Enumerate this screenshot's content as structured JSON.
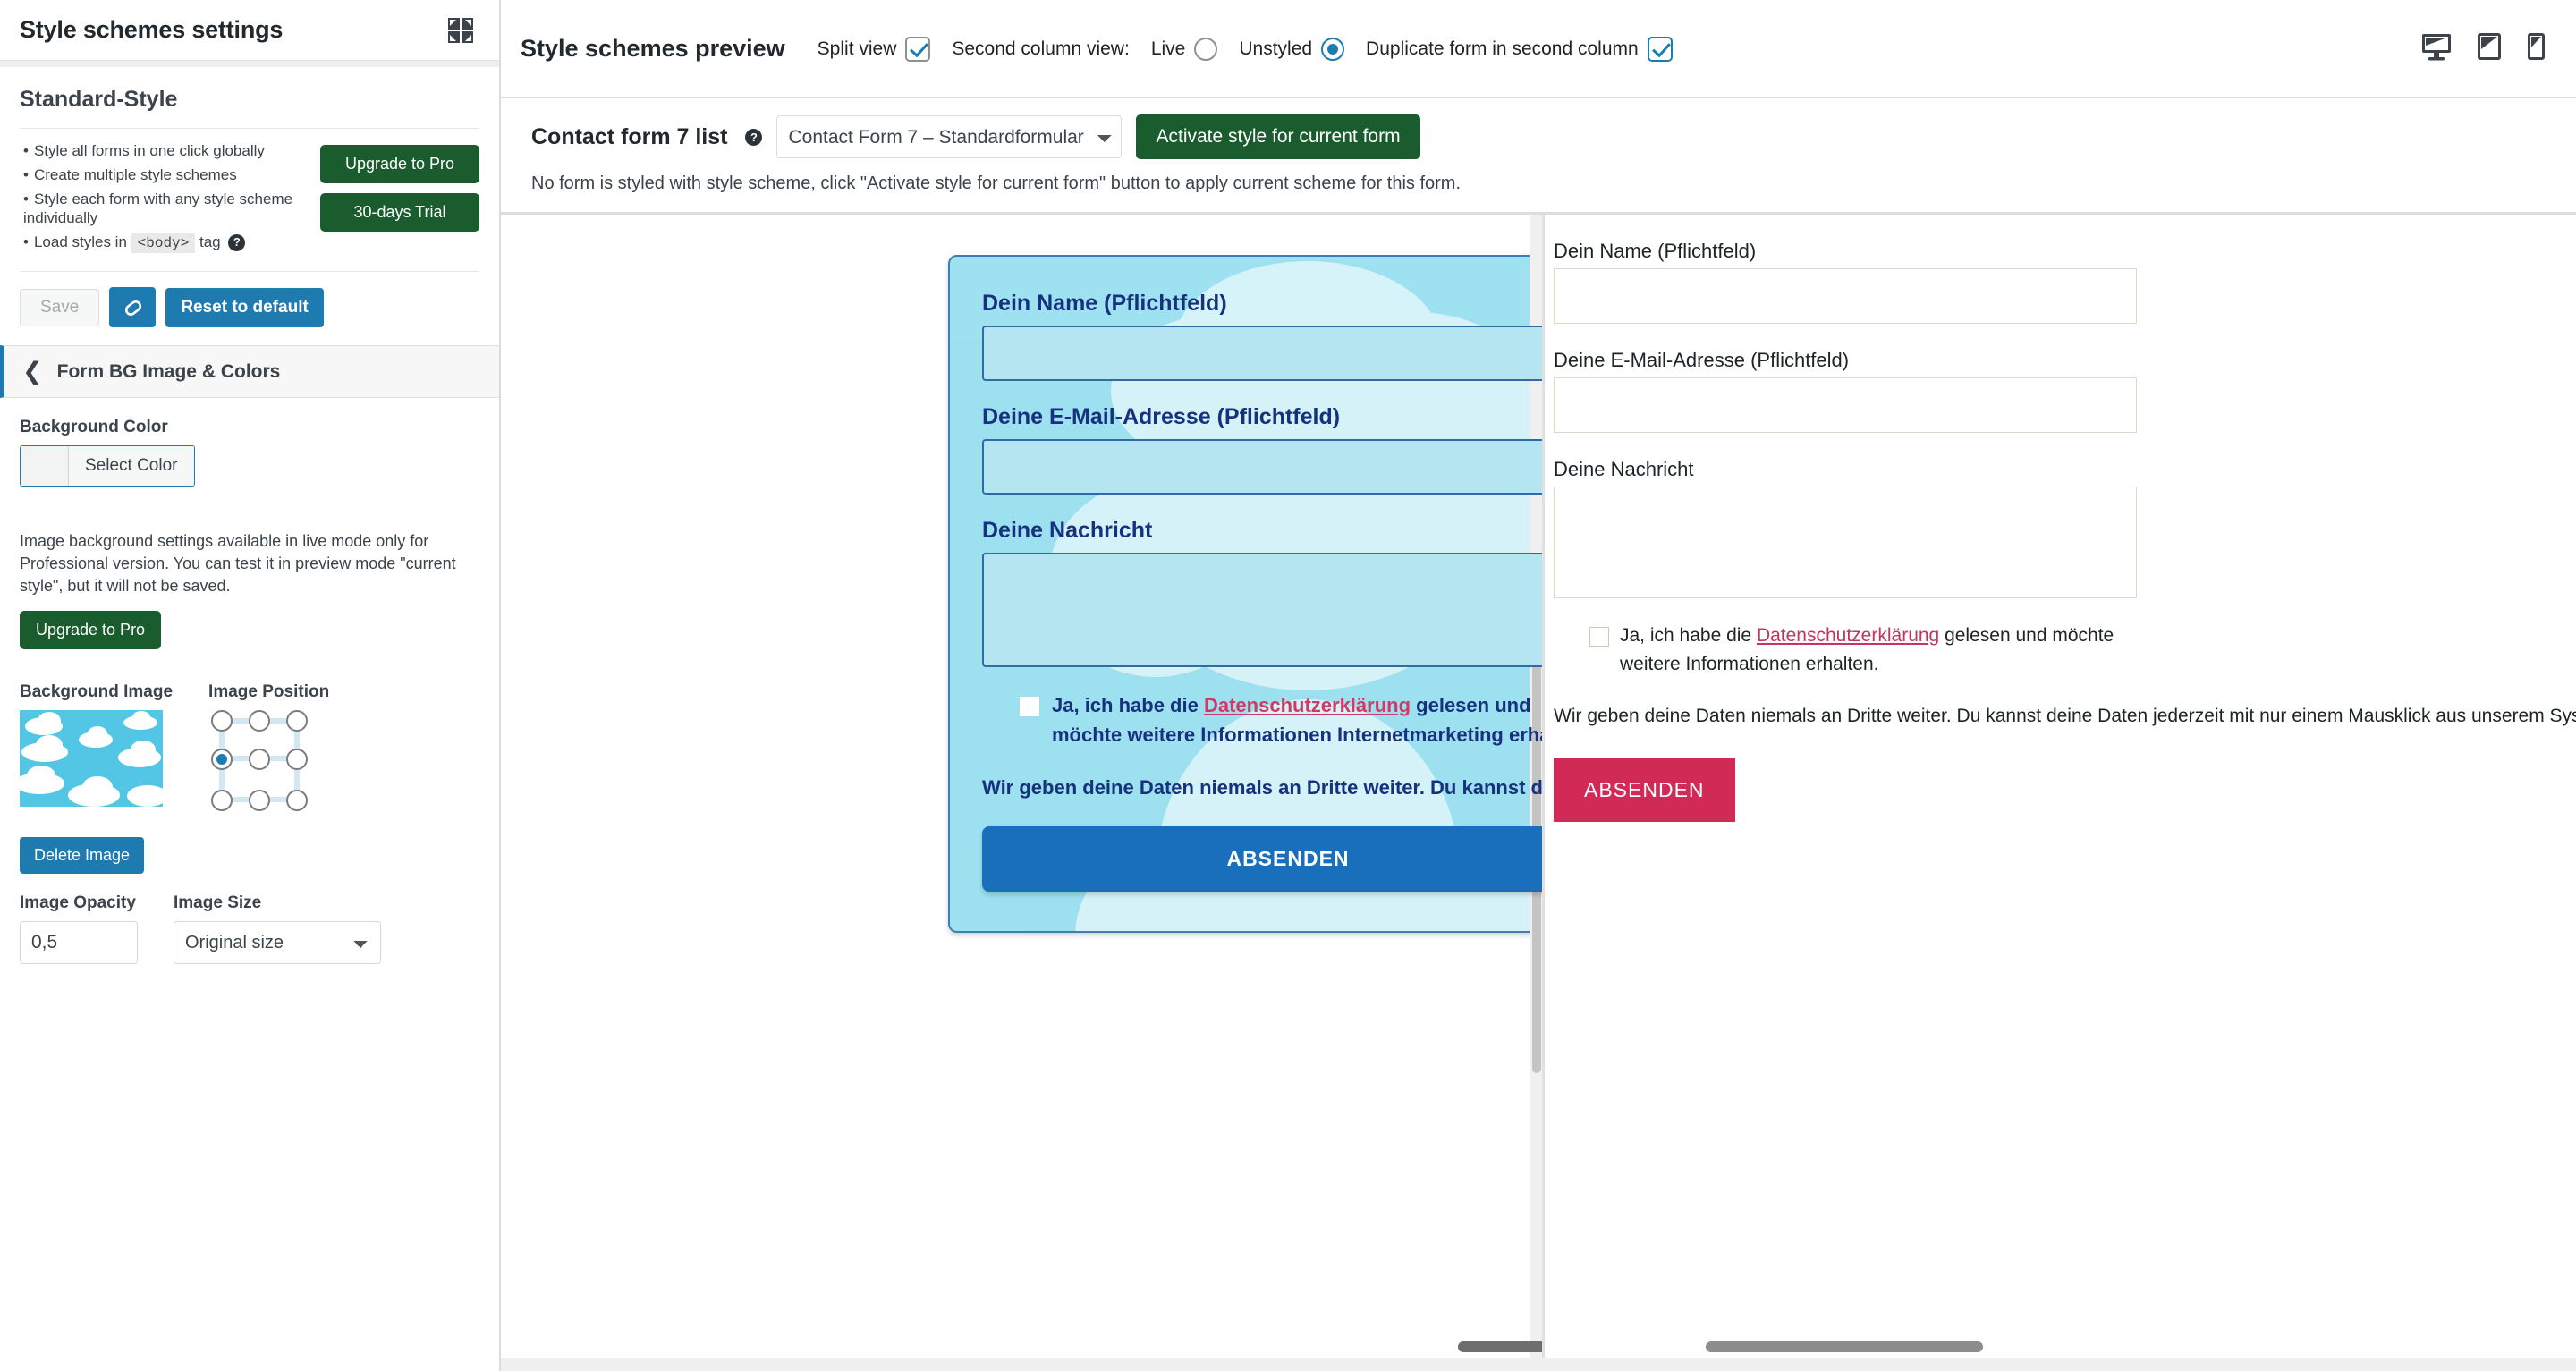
{
  "sidebar": {
    "title": "Style schemes settings",
    "collapse_icon": "collapse-icon",
    "scheme_name": "Standard-Style",
    "features": [
      "Style all forms in one click globally",
      "Create multiple style schemes",
      "Style each form with any style scheme individually"
    ],
    "feature_body_prefix": "Load styles in",
    "feature_body_code": "<body>",
    "feature_body_suffix": "tag",
    "help_badge": "?",
    "upgrade_label": "Upgrade to Pro",
    "trial_label": "30-days Trial",
    "save_label": "Save",
    "eraser_icon": "eraser-icon",
    "reset_label": "Reset to default",
    "panel": {
      "back_icon": "chevron-left-icon",
      "title": "Form BG Image & Colors",
      "background_color_label": "Background Color",
      "select_color_label": "Select Color",
      "color_value": "",
      "pro_note": "Image background settings available in live mode only for Professional version. You can test it in preview mode \"current style\", but it will not be saved.",
      "upgrade_label": "Upgrade to Pro",
      "background_image_label": "Background Image",
      "image_position_label": "Image Position",
      "selected_position": "middle-left",
      "delete_image_label": "Delete Image",
      "image_opacity_label": "Image Opacity",
      "image_opacity_value": "0,5",
      "image_size_label": "Image Size",
      "image_size_value": "Original size",
      "image_size_options": [
        "Original size"
      ]
    }
  },
  "preview": {
    "title": "Style schemes preview",
    "split_view_label": "Split view",
    "split_view_checked": true,
    "second_column_view_label": "Second column view:",
    "live_label": "Live",
    "live_selected": false,
    "unstyled_label": "Unstyled",
    "unstyled_selected": true,
    "duplicate_label": "Duplicate form in second column",
    "duplicate_checked": true,
    "devices": [
      {
        "name": "desktop-view-icon"
      },
      {
        "name": "tablet-view-icon"
      },
      {
        "name": "mobile-view-icon"
      }
    ],
    "cf7_label": "Contact form 7 list",
    "cf7_help": "?",
    "cf7_selected": "Contact Form 7 – Standardformular",
    "cf7_options": [
      "Contact Form 7 – Standardformular"
    ],
    "activate_label": "Activate style for current form",
    "status_note": "No form is styled with style scheme, click \"Activate style for current form\" button to apply current scheme for this form."
  },
  "styled_form": {
    "name_label": "Dein Name (Pflichtfeld)",
    "email_label": "Deine E-Mail-Adresse (Pflichtfeld)",
    "message_label": "Deine Nachricht",
    "consent_prefix": "Ja, ich habe die",
    "consent_link": "Datenschutzerklärung",
    "consent_suffix": "gelesen und möchte weitere Informationen Internetmarketing erhalten.",
    "privacy_note": "Wir geben deine Daten niemals an Dritte weiter. Du kannst deine Daten jederzeit mit nur einem Mausklick aus unserem System löschen.",
    "submit_label": "ABSENDEN"
  },
  "unstyled_form": {
    "name_label": "Dein Name (Pflichtfeld)",
    "email_label": "Deine E-Mail-Adresse (Pflichtfeld)",
    "message_label": "Deine Nachricht",
    "consent_prefix": "Ja, ich habe die",
    "consent_link": "Datenschutzerklärung",
    "consent_suffix": "gelesen und möchte weitere Informationen erhalten.",
    "privacy_note": "Wir geben deine Daten niemals an Dritte weiter. Du kannst deine Daten jederzeit mit nur einem Mausklick aus unserem System löschen.",
    "submit_label": "ABSENDEN"
  },
  "colors": {
    "accent_blue": "#1d7bb0",
    "accent_green": "#1a5c2d",
    "styled_form_bg": "#ace6f2",
    "styled_text": "#16317e",
    "styled_submit": "#1a6fbd",
    "unstyled_submit": "#d12a57",
    "link_pink": "#d33a63",
    "sky_blue": "#53c5e5"
  }
}
